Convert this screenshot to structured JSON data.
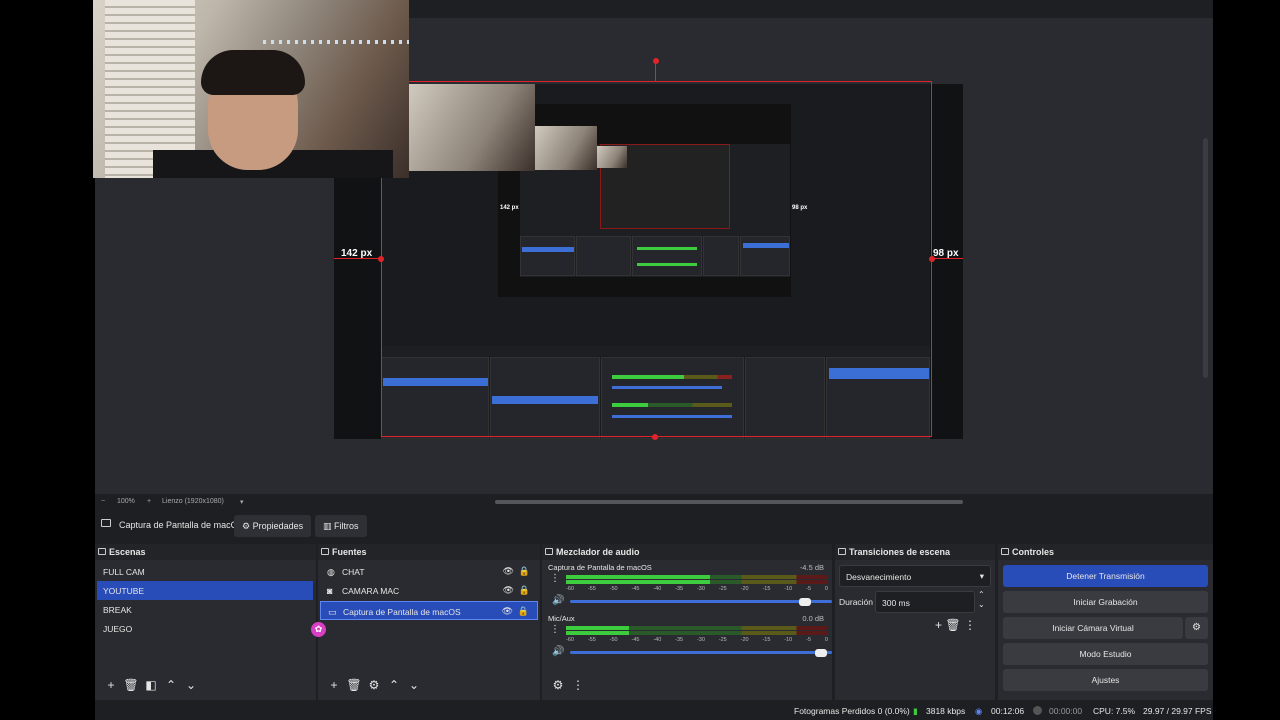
{
  "preview": {
    "left_px_label": "142 px",
    "right_px_label": "98 px",
    "inner_left_px_label": "142 px",
    "inner_right_px_label": "98 px"
  },
  "canvas_bar": {
    "zoom_out": "−",
    "zoom": "100%",
    "zoom_in": "+",
    "canvas_label": "Lienzo (1920x1080)"
  },
  "source_bar": {
    "source_name": "Captura de Pantalla de macC",
    "properties_label": "Propiedades",
    "filters_label": "Filtros"
  },
  "scenes": {
    "title": "Escenas",
    "items": [
      {
        "label": "FULL CAM"
      },
      {
        "label": "YOUTUBE"
      },
      {
        "label": "BREAK"
      },
      {
        "label": "JUEGO"
      }
    ]
  },
  "sources": {
    "title": "Fuentes",
    "items": [
      {
        "label": "CHAT"
      },
      {
        "label": "CAMARA MAC"
      },
      {
        "label": "Captura de Pantalla de macOS"
      }
    ]
  },
  "mixer": {
    "title": "Mezclador de audio",
    "channels": [
      {
        "name": "Captura de Pantalla de macOS",
        "db": "-4.5 dB",
        "level": 0.55,
        "volume": 0.92
      },
      {
        "name": "Mic/Aux",
        "db": "0.0 dB",
        "level": 0.24,
        "volume": 0.98
      }
    ],
    "ticks": [
      "-60",
      "-55",
      "-50",
      "-45",
      "-40",
      "-35",
      "-30",
      "-25",
      "-20",
      "-15",
      "-10",
      "-5",
      "0"
    ]
  },
  "transitions": {
    "title": "Transiciones de escena",
    "transition": "Desvanecimiento",
    "duration_label": "Duración",
    "duration_value": "300 ms"
  },
  "controls": {
    "title": "Controles",
    "stop_stream": "Detener Transmisión",
    "start_recording": "Iniciar Grabación",
    "start_virtual_cam": "Iniciar Cámara Virtual",
    "studio_mode": "Modo Estudio",
    "settings": "Ajustes"
  },
  "status": {
    "dropped_frames": "Fotogramas Perdidos 0 (0.0%)",
    "bitrate": "3818 kbps",
    "stream_time": "00:12:06",
    "rec_time": "00:00:00",
    "cpu": "CPU: 7.5%",
    "fps": "29.97 / 29.97 FPS"
  },
  "colors": {
    "accent": "#284cb8",
    "selection": "#e0242a",
    "background": "#1e1f22"
  }
}
